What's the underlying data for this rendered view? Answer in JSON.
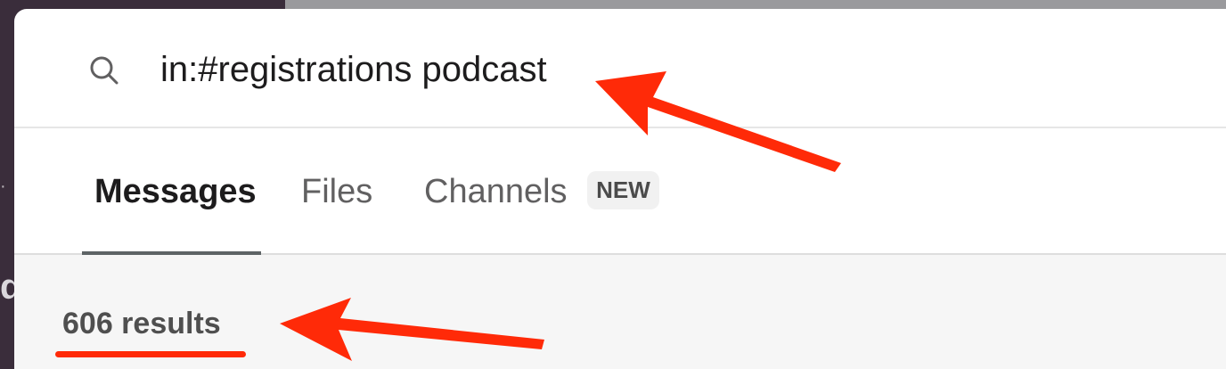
{
  "search": {
    "query": "in:#registrations podcast"
  },
  "tabs": [
    {
      "label": "Messages",
      "active": true
    },
    {
      "label": "Files",
      "active": false
    },
    {
      "label": "Channels",
      "active": false,
      "badge": "NEW"
    }
  ],
  "results": {
    "count_text": "606 results"
  },
  "sidebar": {
    "partial_letter": "d",
    "partial_dots": "· · ·"
  },
  "colors": {
    "annotation": "#ff2a08",
    "text_primary": "#1d1c1d",
    "text_secondary": "#616061"
  },
  "icons": {
    "search": "search-icon"
  }
}
